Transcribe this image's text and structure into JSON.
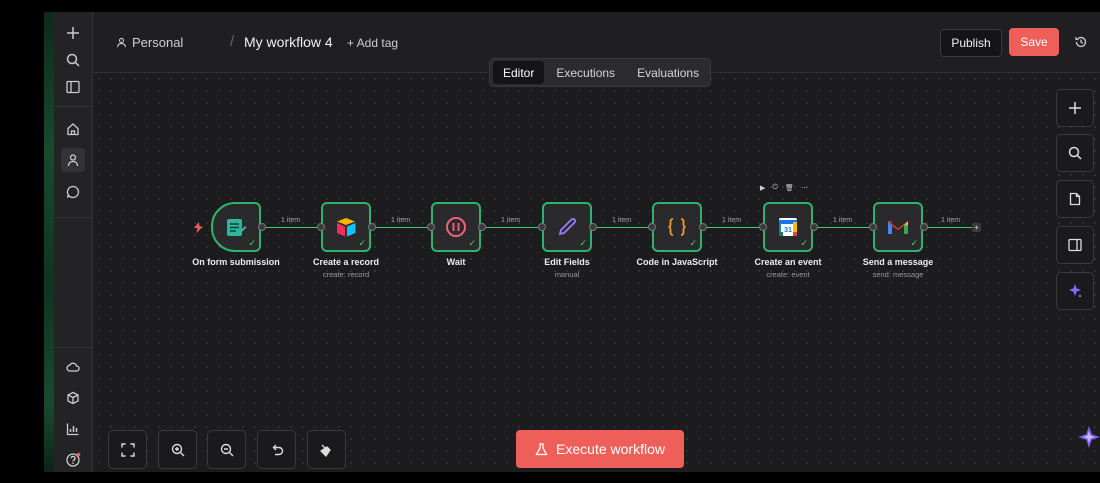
{
  "breadcrumb": {
    "project": "Personal",
    "workflow": "My workflow 4",
    "add_tag": "+ Add tag"
  },
  "header": {
    "publish": "Publish",
    "save": "Save"
  },
  "tabs": [
    "Editor",
    "Executions",
    "Evaluations"
  ],
  "nodes": [
    {
      "label": "On form submission",
      "sub": ""
    },
    {
      "label": "Create a record",
      "sub": "create: record"
    },
    {
      "label": "Wait",
      "sub": ""
    },
    {
      "label": "Edit Fields",
      "sub": "manual"
    },
    {
      "label": "Code in JavaScript",
      "sub": ""
    },
    {
      "label": "Create an event",
      "sub": "create: event"
    },
    {
      "label": "Send a message",
      "sub": "send: message"
    }
  ],
  "connection_label": "1 item",
  "execute": "Execute workflow",
  "colors": {
    "accent": "#ef5f5a",
    "node_border": "#2fb36a"
  }
}
